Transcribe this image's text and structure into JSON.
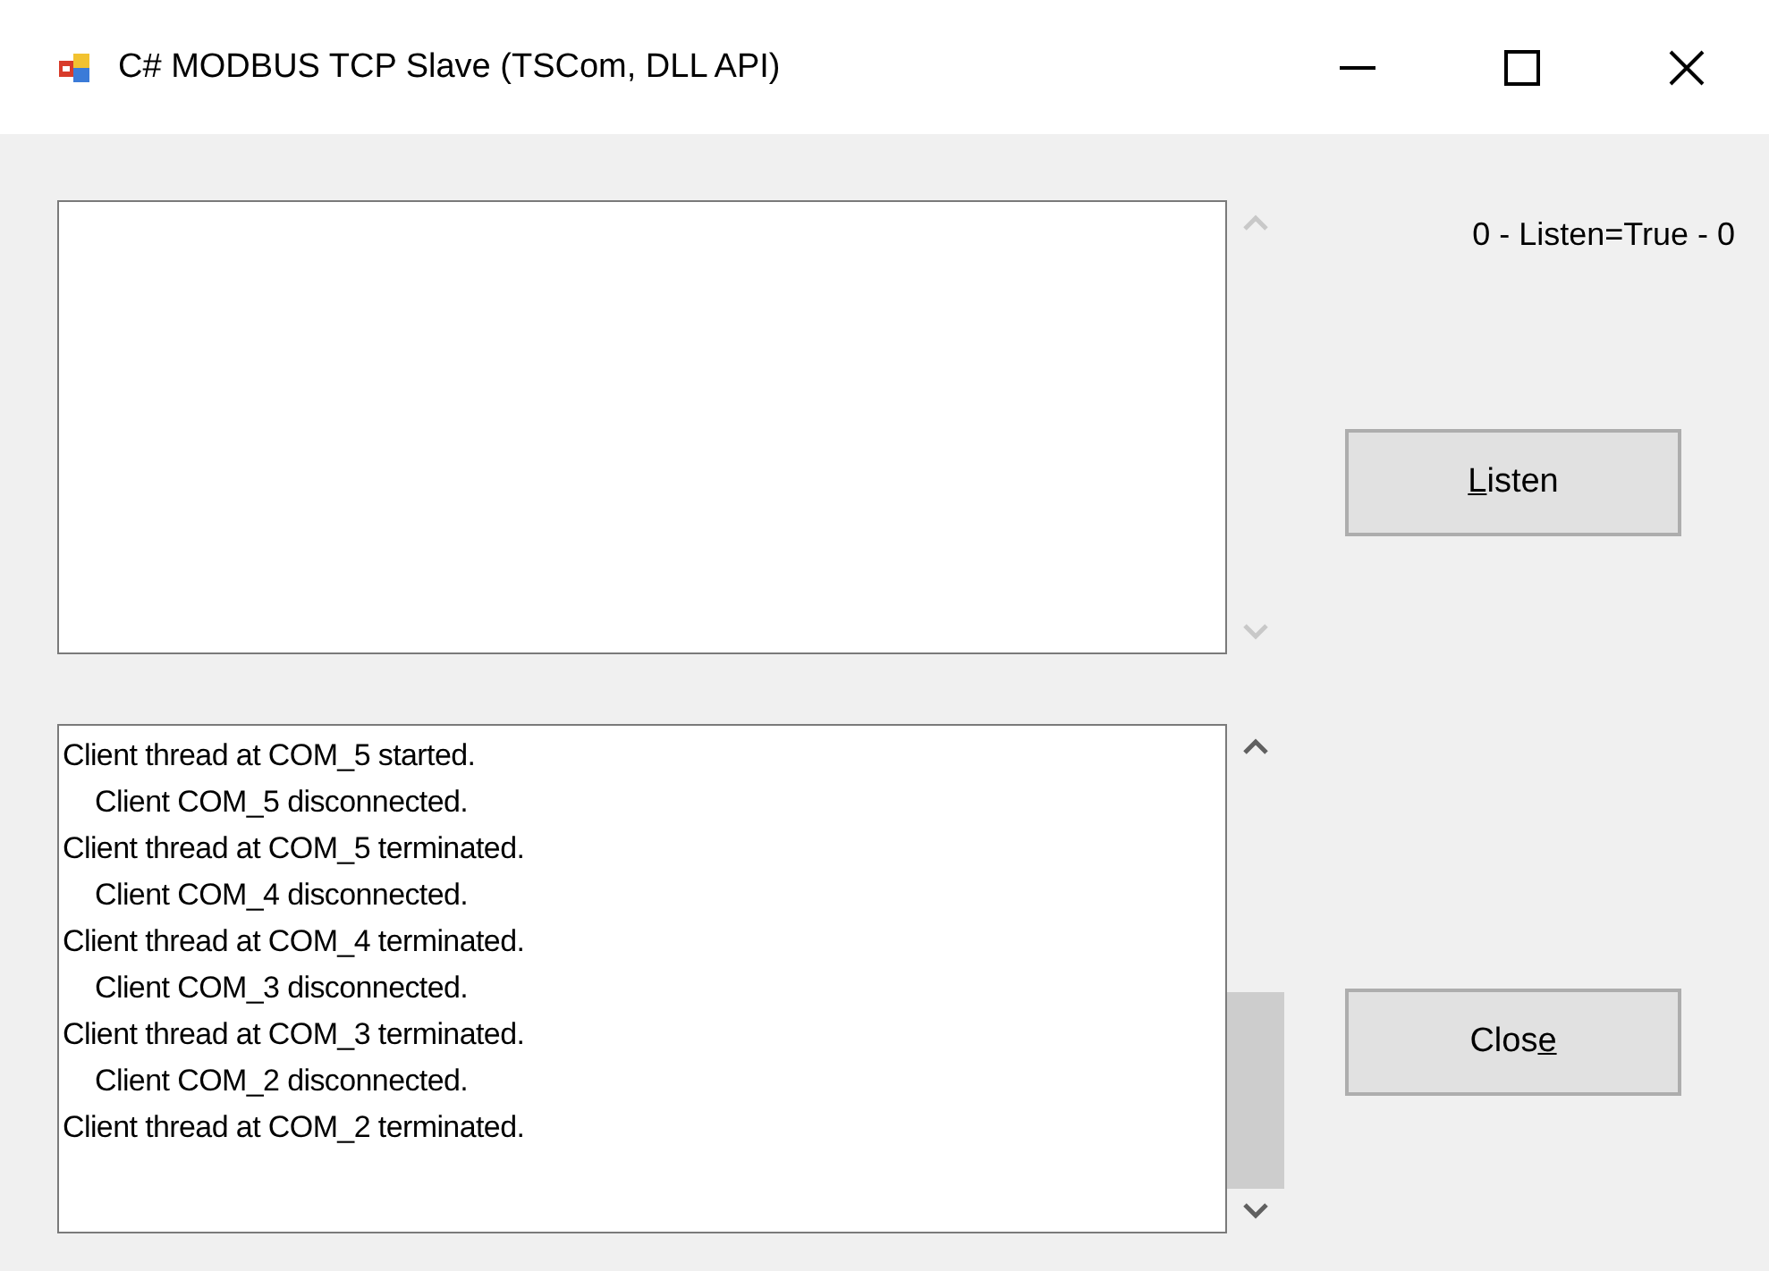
{
  "window": {
    "title": "C# MODBUS TCP Slave (TSCom, DLL API)"
  },
  "top_box": {
    "scrollbar_enabled": false
  },
  "status_label": "0 - Listen=True - 0",
  "buttons": [
    {
      "access_key": "L",
      "after": "isten"
    },
    {
      "before": "Clos",
      "access_key": "e"
    }
  ],
  "log_box": {
    "scrollbar_enabled": true,
    "lines": [
      {
        "text": "Client thread at COM_5 started.",
        "indented": false
      },
      {
        "text": "Client COM_5 disconnected.",
        "indented": true
      },
      {
        "text": "Client thread at COM_5 terminated.",
        "indented": false
      },
      {
        "text": "Client COM_4 disconnected.",
        "indented": true
      },
      {
        "text": "Client thread at COM_4 terminated.",
        "indented": false
      },
      {
        "text": "Client COM_3 disconnected.",
        "indented": true
      },
      {
        "text": "Client thread at COM_3 terminated.",
        "indented": false
      },
      {
        "text": "Client COM_2 disconnected.",
        "indented": true
      },
      {
        "text": "Client thread at COM_2 terminated.",
        "indented": false
      }
    ]
  }
}
